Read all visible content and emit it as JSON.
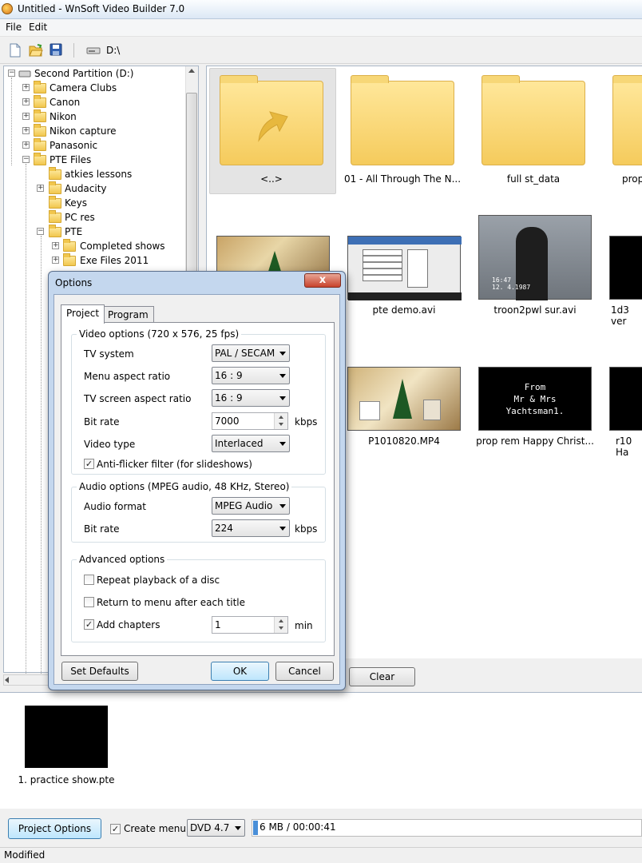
{
  "window": {
    "title": "Untitled - WnSoft Video Builder 7.0"
  },
  "menu": {
    "file": "File",
    "edit": "Edit"
  },
  "toolbar": {
    "drive": "D:\\"
  },
  "tree": {
    "items": [
      {
        "label": "Second Partition (D:)"
      },
      {
        "label": "Camera Clubs"
      },
      {
        "label": "Canon"
      },
      {
        "label": "Nikon"
      },
      {
        "label": "Nikon capture"
      },
      {
        "label": "Panasonic"
      },
      {
        "label": "PTE Files"
      },
      {
        "label": "atkies lessons"
      },
      {
        "label": "Audacity"
      },
      {
        "label": "Keys"
      },
      {
        "label": "PC res"
      },
      {
        "label": "PTE"
      },
      {
        "label": "Completed shows"
      },
      {
        "label": "Exe Files 2011"
      }
    ]
  },
  "files": {
    "items": [
      {
        "label": "<..>"
      },
      {
        "label": "01 - All Through The N..."
      },
      {
        "label": "full st_data"
      },
      {
        "label": "prop"
      },
      {
        "label": "pte demo.avi"
      },
      {
        "label": "troon2pwl sur.avi"
      },
      {
        "label": "1d3 ver"
      },
      {
        "label": "P1010820.MP4"
      },
      {
        "label": "prop rem Happy Christ..."
      },
      {
        "label": "r10 Ha"
      }
    ],
    "thumb_text": {
      "line1": "From",
      "line2": "Mr & Mrs",
      "line3": "Yachtsman1.",
      "timestamp": "16:47\n12. 4.1987"
    }
  },
  "clear_button": "Clear",
  "project": {
    "item": "1. practice show.pte"
  },
  "bottom": {
    "project_options": "Project Options",
    "create_menu": "Create menu",
    "disc": "DVD 4.7",
    "usage": "6 MB / 00:00:41"
  },
  "status": {
    "text": "Modified"
  },
  "dialog": {
    "title": "Options",
    "close": "x",
    "tabs": {
      "project": "Project",
      "program": "Program"
    },
    "video": {
      "group": "Video options (720 x 576, 25 fps)",
      "tv_system_label": "TV system",
      "tv_system": "PAL / SECAM",
      "menu_aspect_label": "Menu aspect ratio",
      "menu_aspect": "16 : 9",
      "tv_aspect_label": "TV screen aspect ratio",
      "tv_aspect": "16 : 9",
      "bitrate_label": "Bit rate",
      "bitrate": "7000",
      "bitrate_unit": "kbps",
      "video_type_label": "Video type",
      "video_type": "Interlaced",
      "antiflicker": "Anti-flicker filter (for slideshows)"
    },
    "audio": {
      "group": "Audio options (MPEG audio, 48 KHz, Stereo)",
      "format_label": "Audio format",
      "format": "MPEG Audio",
      "bitrate_label": "Bit rate",
      "bitrate": "224",
      "bitrate_unit": "kbps"
    },
    "advanced": {
      "group": "Advanced options",
      "repeat": "Repeat playback of a disc",
      "return_menu": "Return to menu after each title",
      "chapters": "Add chapters",
      "chapters_value": "1",
      "chapters_unit": "min"
    },
    "buttons": {
      "defaults": "Set Defaults",
      "ok": "OK",
      "cancel": "Cancel"
    }
  }
}
